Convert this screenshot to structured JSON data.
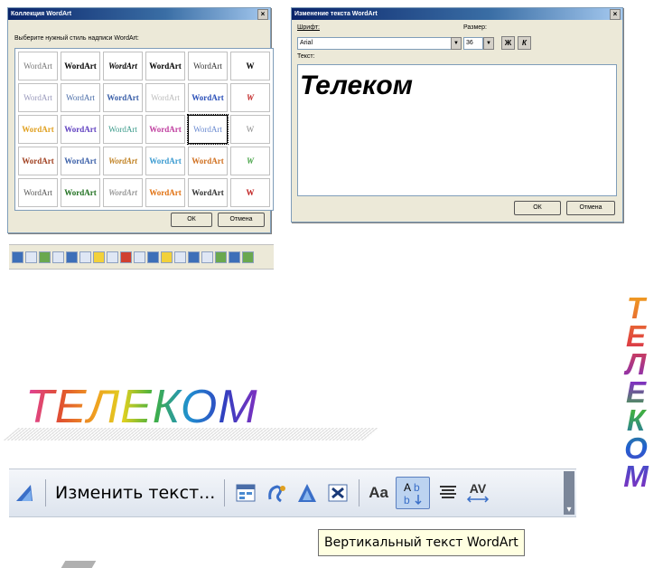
{
  "gallery_dialog": {
    "title": "Коллекция WordArt",
    "close": "×",
    "prompt": "Выберите нужный стиль надписи WordArt:",
    "ok": "ОК",
    "cancel": "Отмена",
    "styles": [
      "WordArt",
      "WordArt",
      "WordArt",
      "WordArt",
      "WordArt",
      "W",
      "WordArt",
      "WordArt",
      "WordArt",
      "WordArt",
      "WordArt",
      "W",
      "WordArt",
      "WordArt",
      "WordArt",
      "WordArt",
      "WordArt",
      "W",
      "WordArt",
      "WordArt",
      "WordArt",
      "WordArt",
      "WordArt",
      "W",
      "WordArt",
      "WordArt",
      "WordArt",
      "WordArt",
      "WordArt",
      "W"
    ]
  },
  "edit_dialog": {
    "title": "Изменение текста WordArt",
    "close": "×",
    "font_label": "Шрифт:",
    "font_value": "Arial",
    "size_label": "Размер:",
    "size_value": "36",
    "bold_btn": "Ж",
    "italic_btn": "К",
    "text_label": "Текст:",
    "text_value": "Телеком",
    "ok": "ОК",
    "cancel": "Отмена"
  },
  "wordart_horizontal": "ТЕЛЕКОМ",
  "wordart_vertical": "ТЕЛЕКОМ",
  "wordart_toolbar": {
    "edit_text": "Изменить текст...",
    "aa_label": "Aa",
    "av_label": "AV"
  },
  "tooltip": "Вертикальный текст WordArt",
  "colors": {
    "titlebar": "#0a246a",
    "dialog_bg": "#ece9d8",
    "toolbar_bg": "#dde4ee",
    "tooltip_bg": "#ffffe1"
  }
}
